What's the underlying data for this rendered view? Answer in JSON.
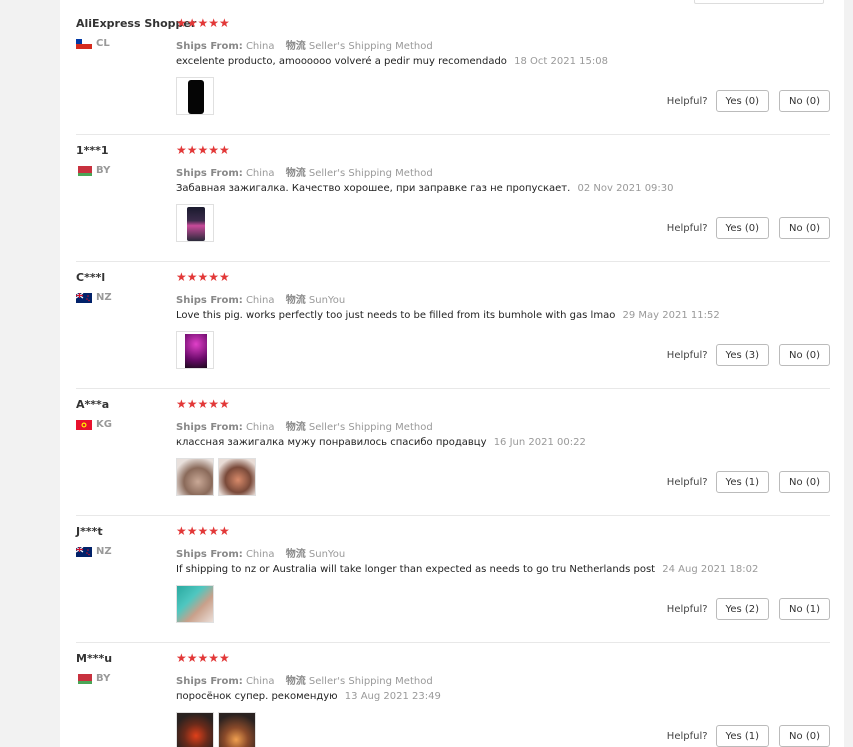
{
  "reviews": [
    {
      "user": "AliExpress Shopper",
      "country": "CL",
      "stars": "★★★★★",
      "ships_from_label": "Ships From:",
      "ships_from": "China",
      "shipping_method_label": "物流",
      "shipping_method": "Seller's Shipping Method",
      "text": "excelente producto, amoooooo volveré a pedir muy recomendado",
      "date": "18 Oct 2021 15:08",
      "helpful_label": "Helpful?",
      "yes": "Yes (0)",
      "no": "No (0)"
    },
    {
      "user": "1***1",
      "country": "BY",
      "stars": "★★★★★",
      "ships_from_label": "Ships From:",
      "ships_from": "China",
      "shipping_method_label": "物流",
      "shipping_method": "Seller's Shipping Method",
      "text": "Забавная зажигалка. Качество хорошее, при заправке газ не пропускает.",
      "date": "02 Nov 2021 09:30",
      "helpful_label": "Helpful?",
      "yes": "Yes (0)",
      "no": "No (0)"
    },
    {
      "user": "C***l",
      "country": "NZ",
      "stars": "★★★★★",
      "ships_from_label": "Ships From:",
      "ships_from": "China",
      "shipping_method_label": "物流",
      "shipping_method": "SunYou",
      "text": "Love this pig. works perfectly too just needs to be filled from its bumhole with gas lmao",
      "date": "29 May 2021 11:52",
      "helpful_label": "Helpful?",
      "yes": "Yes (3)",
      "no": "No (0)"
    },
    {
      "user": "A***a",
      "country": "KG",
      "stars": "★★★★★",
      "ships_from_label": "Ships From:",
      "ships_from": "China",
      "shipping_method_label": "物流",
      "shipping_method": "Seller's Shipping Method",
      "text": "классная зажигалка мужу понравилось спасибо продавцу",
      "date": "16 Jun 2021 00:22",
      "helpful_label": "Helpful?",
      "yes": "Yes (1)",
      "no": "No (0)"
    },
    {
      "user": "J***t",
      "country": "NZ",
      "stars": "★★★★★",
      "ships_from_label": "Ships From:",
      "ships_from": "China",
      "shipping_method_label": "物流",
      "shipping_method": "SunYou",
      "text": "If shipping to nz or Australia will take longer than expected as needs to go tru Netherlands post",
      "date": "24 Aug 2021 18:02",
      "helpful_label": "Helpful?",
      "yes": "Yes (2)",
      "no": "No (1)"
    },
    {
      "user": "M***u",
      "country": "BY",
      "stars": "★★★★★",
      "ships_from_label": "Ships From:",
      "ships_from": "China",
      "shipping_method_label": "物流",
      "shipping_method": "Seller's Shipping Method",
      "text": "поросёнок супер. рекомендую",
      "date": "13 Aug 2021 23:49",
      "helpful_label": "Helpful?",
      "yes": "Yes (1)",
      "no": "No (0)"
    }
  ],
  "colors": {
    "star": "#e23838",
    "muted": "#999999",
    "border": "#e8e8e8",
    "button_border": "#bbbbbb"
  }
}
